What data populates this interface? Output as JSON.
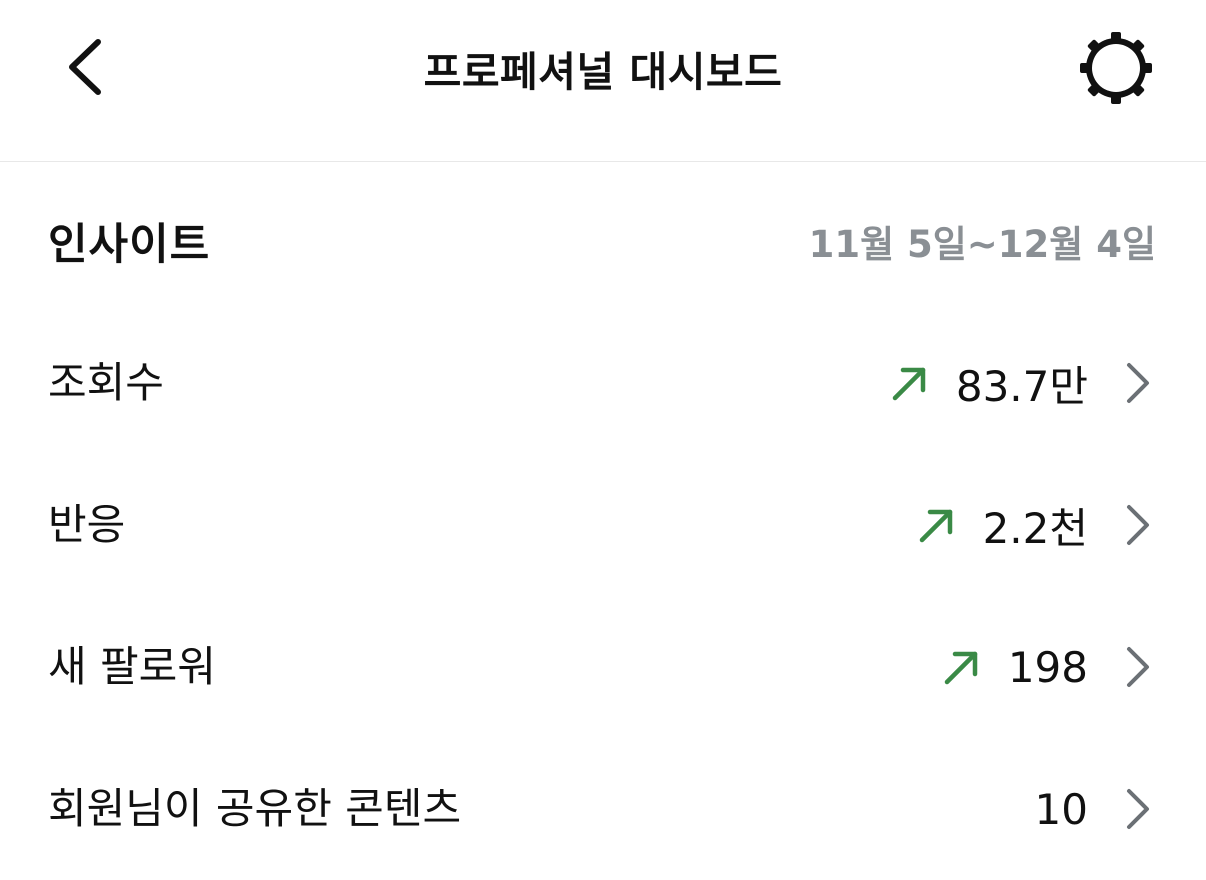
{
  "header": {
    "title": "프로페셔널 대시보드",
    "back_icon": "chevron-left-icon",
    "settings_icon": "gear-icon"
  },
  "insights": {
    "title": "인사이트",
    "date_range": "11월 5일~12월 4일",
    "rows": [
      {
        "label": "조회수",
        "value": "83.7만",
        "trend": "up"
      },
      {
        "label": "반응",
        "value": "2.2천",
        "trend": "up"
      },
      {
        "label": "새 팔로워",
        "value": "198",
        "trend": "up"
      },
      {
        "label": "회원님이 공유한 콘텐츠",
        "value": "10",
        "trend": "none"
      }
    ]
  },
  "colors": {
    "trend_up": "#3a8a46",
    "secondary_text": "#8a8f94",
    "chevron": "#6b7075",
    "divider": "#e8e8e8"
  }
}
